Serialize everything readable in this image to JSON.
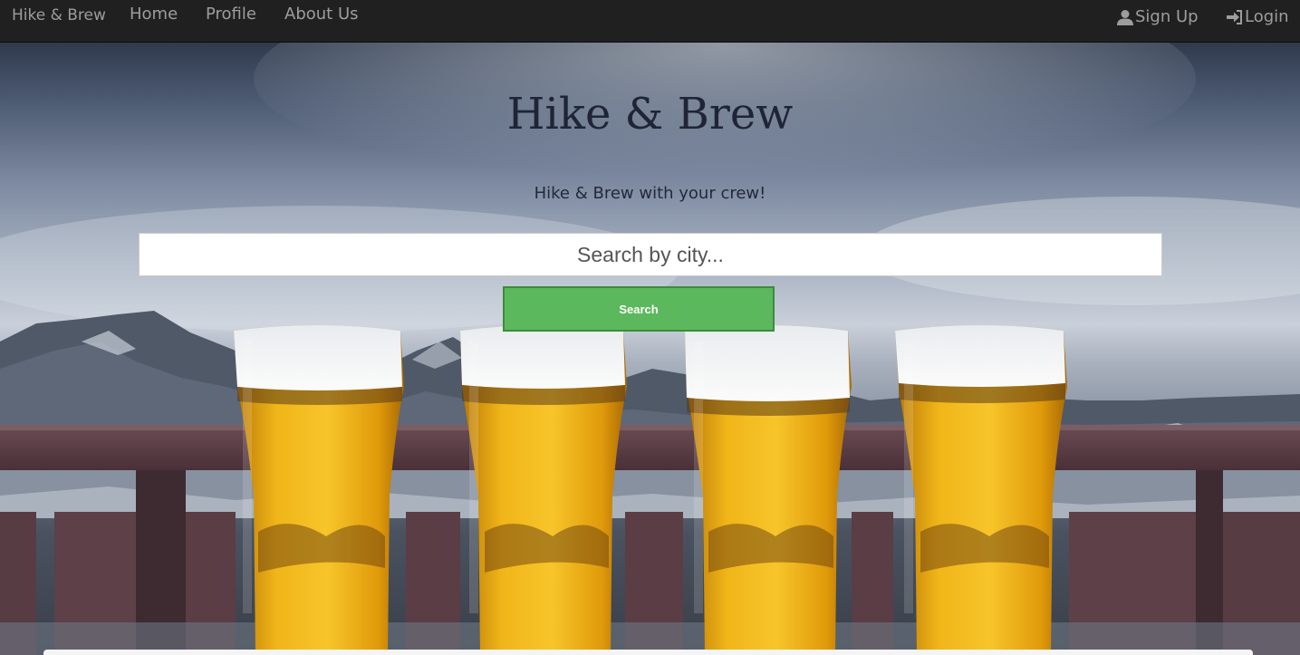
{
  "nav": {
    "brand": "Hike & Brew",
    "links": [
      {
        "label": "Home"
      },
      {
        "label": "Profile"
      },
      {
        "label": "About Us"
      }
    ],
    "signup": {
      "label": "Sign Up",
      "icon": "user-icon"
    },
    "login": {
      "label": "Login",
      "icon": "login-icon"
    }
  },
  "hero": {
    "title": "Hike & Brew",
    "subtitle": "Hike & Brew with your crew!",
    "search": {
      "placeholder": "Search by city...",
      "value": ""
    },
    "button_label": "Search",
    "background": "mountain-beer-photo"
  },
  "colors": {
    "navbar": "#202020",
    "nav_text": "#9d9d9d",
    "button": "#5cb85c",
    "beer": "#e8a80c",
    "foam": "#f2f2ee"
  }
}
